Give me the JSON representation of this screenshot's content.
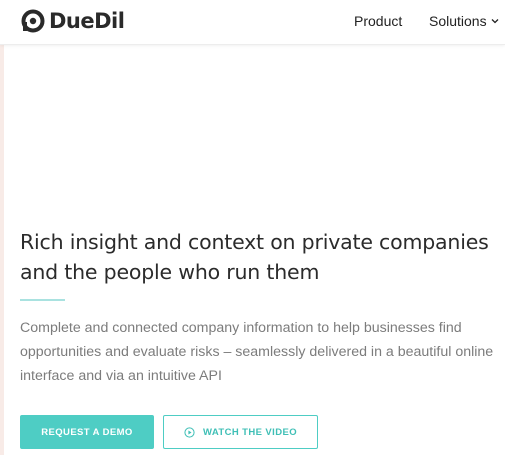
{
  "header": {
    "logo_text": "DueDil",
    "nav": {
      "product": "Product",
      "solutions": "Solutions"
    }
  },
  "hero": {
    "headline": "Rich insight and context on private companies and the people who run them",
    "description": "Complete and connected company information to help businesses find opportunities and evaluate risks – seamlessly delivered in a beautiful online interface and via an intuitive API",
    "demo_button": "REQUEST A DEMO",
    "video_button": "WATCH THE VIDEO"
  },
  "icons": {
    "logo": "duedil-logo-icon",
    "solutions_dropdown": "chevron-down-icon",
    "video": "play-circle-icon"
  },
  "colors": {
    "accent": "#4ecdc4",
    "divider": "#a9e2e0",
    "text_dark": "#2b2b2b",
    "text_muted": "#7c7c7c"
  }
}
